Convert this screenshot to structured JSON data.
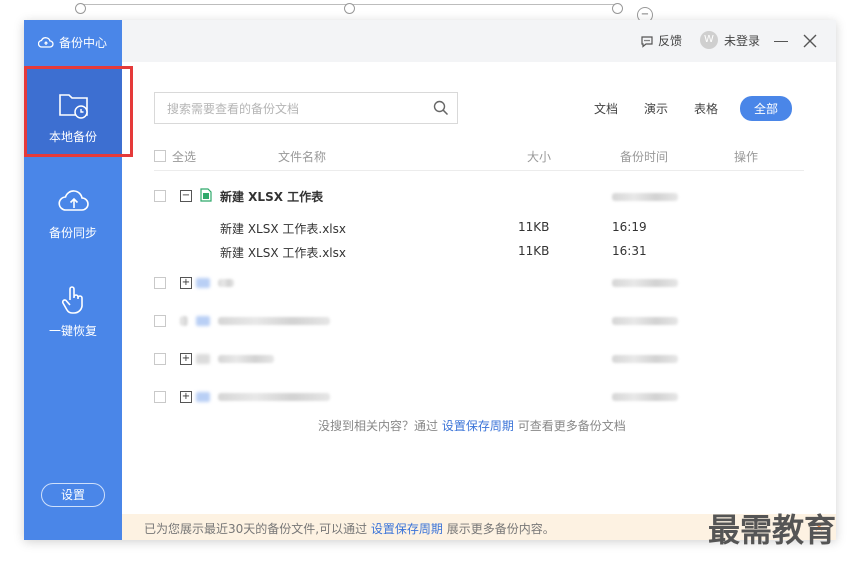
{
  "app": {
    "title": "备份中心"
  },
  "sidebar": {
    "items": [
      {
        "label": "本地备份",
        "icon": "folder-clock-icon"
      },
      {
        "label": "备份同步",
        "icon": "cloud-upload-icon"
      },
      {
        "label": "一键恢复",
        "icon": "hand-pointer-icon"
      }
    ],
    "settings_label": "设置"
  },
  "topbar": {
    "feedback": "反馈",
    "login": "未登录",
    "avatar_letter": "W"
  },
  "search": {
    "placeholder": "搜索需要查看的备份文档"
  },
  "filters": [
    "文档",
    "演示",
    "表格",
    "全部"
  ],
  "table": {
    "headers": {
      "select_all": "全选",
      "name": "文件名称",
      "size": "大小",
      "time": "备份时间",
      "action": "操作"
    },
    "group": {
      "name": "新建 XLSX 工作表",
      "files": [
        {
          "name": "新建 XLSX 工作表.xlsx",
          "size": "11KB",
          "time": "16:19"
        },
        {
          "name": "新建 XLSX 工作表.xlsx",
          "size": "11KB",
          "time": "16:31"
        }
      ]
    }
  },
  "empty_note": {
    "prefix": "没搜到相关内容？通过",
    "link": "设置保存周期",
    "suffix": "可查看更多备份文档"
  },
  "footer": {
    "prefix": "已为您展示最近30天的备份文件,可以通过",
    "link": "设置保存周期",
    "suffix": "展示更多备份内容。",
    "close": "×"
  },
  "watermark": "最需教育",
  "colors": {
    "accent": "#4a86e8",
    "active": "#3d6fd1",
    "highlight": "#e53a3a",
    "link": "#3b74d8"
  }
}
